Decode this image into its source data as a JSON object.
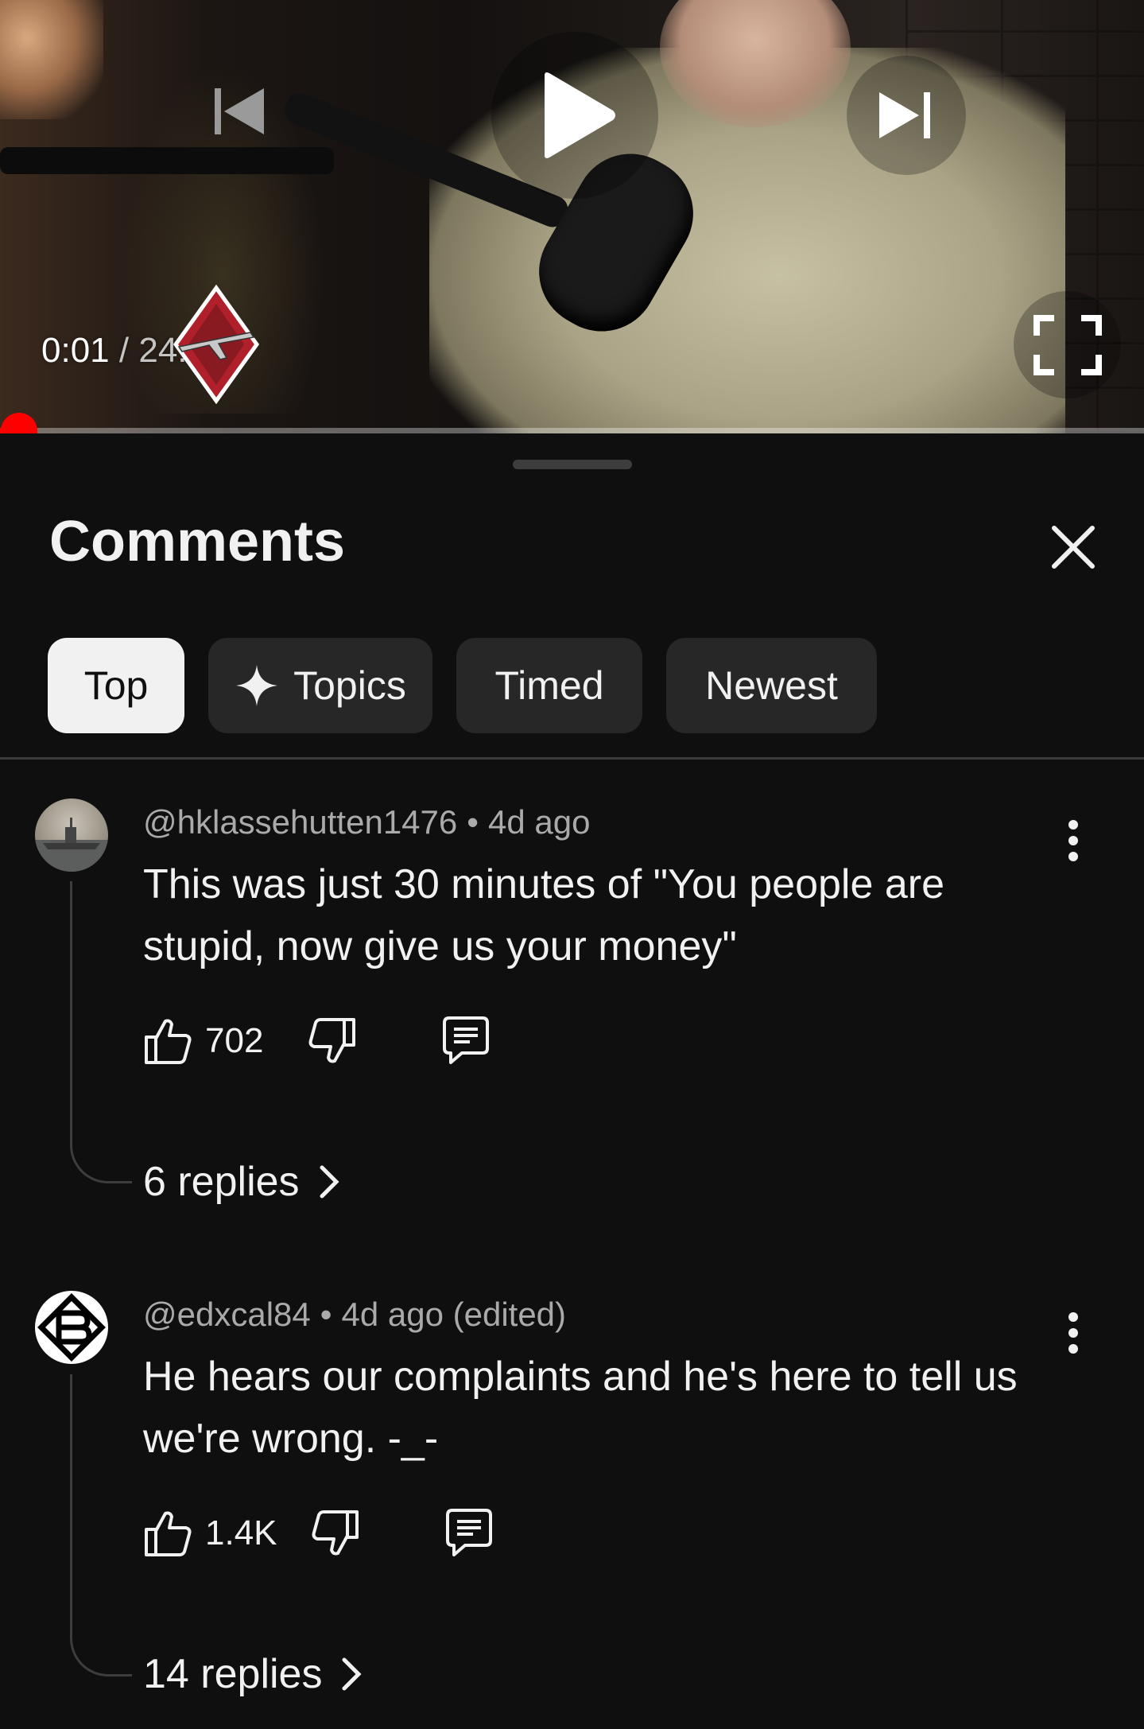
{
  "player": {
    "current_time": "0:01",
    "separator": "/",
    "duration": "24:46",
    "progress_fraction": 0.0007,
    "accent_color": "#ff0000"
  },
  "icons": {
    "previous": "skip-previous-icon",
    "play": "play-icon",
    "next": "skip-next-icon",
    "fullscreen": "fullscreen-icon",
    "close": "close-icon",
    "sparkle": "sparkle-icon",
    "more": "more-vertical-icon",
    "like": "thumbs-up-icon",
    "dislike": "thumbs-down-icon",
    "reply": "reply-icon",
    "chevron": "chevron-right-icon"
  },
  "comments_panel": {
    "title": "Comments",
    "chips": [
      {
        "label": "Top",
        "active": true
      },
      {
        "label": "Topics",
        "active": false
      },
      {
        "label": "Timed",
        "active": false
      },
      {
        "label": "Newest",
        "active": false
      }
    ],
    "comments": [
      {
        "author": "@hklassehutten1476",
        "time": "4d ago",
        "text": "This was just 30 minutes of \"You people are stupid, now give us your money\"",
        "likes": "702",
        "replies": "6 replies"
      },
      {
        "author": "@edxcal84",
        "time": "4d ago (edited)",
        "text": "He hears our complaints and he's here to tell us we're wrong. -_-",
        "likes": "1.4K",
        "replies": "14 replies"
      }
    ]
  }
}
